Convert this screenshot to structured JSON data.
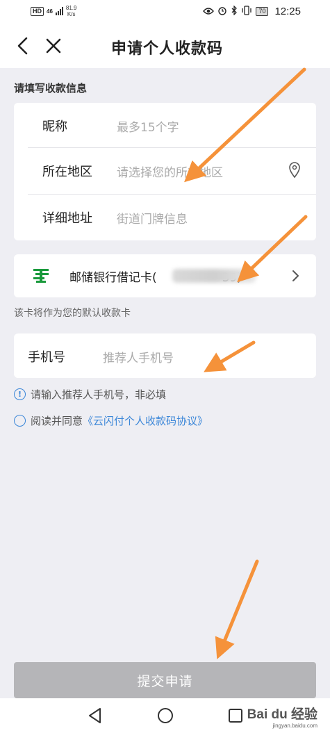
{
  "status_bar": {
    "hd": "HD",
    "network": "46",
    "speed_value": "81.9",
    "speed_unit": "K/s",
    "battery": "70",
    "time": "12:25"
  },
  "nav": {
    "title": "申请个人收款码"
  },
  "form": {
    "section_title": "请填写收款信息",
    "nickname": {
      "label": "昵称",
      "placeholder": "最多15个字"
    },
    "region": {
      "label": "所在地区",
      "placeholder": "请选择您的所在地区"
    },
    "address": {
      "label": "详细地址",
      "placeholder": "街道门牌信息"
    }
  },
  "bank_card": {
    "name": "邮储银行借记卡(",
    "tail": "39)",
    "logo_color": "#1a9a3c"
  },
  "default_card_hint": "该卡将作为您的默认收款卡",
  "phone": {
    "label": "手机号",
    "placeholder": "推荐人手机号"
  },
  "phone_note": "请输入推荐人手机号，非必填",
  "agreement": {
    "prefix": "阅读并同意",
    "link": "《云闪付个人收款码协议》"
  },
  "submit_label": "提交申请",
  "watermark": {
    "brand": "Bai du 经验",
    "url": "jingyan.baidu.com"
  },
  "colors": {
    "accent": "#3a86d8",
    "arrow": "#f5923a",
    "button_disabled": "#b5b5b8"
  }
}
